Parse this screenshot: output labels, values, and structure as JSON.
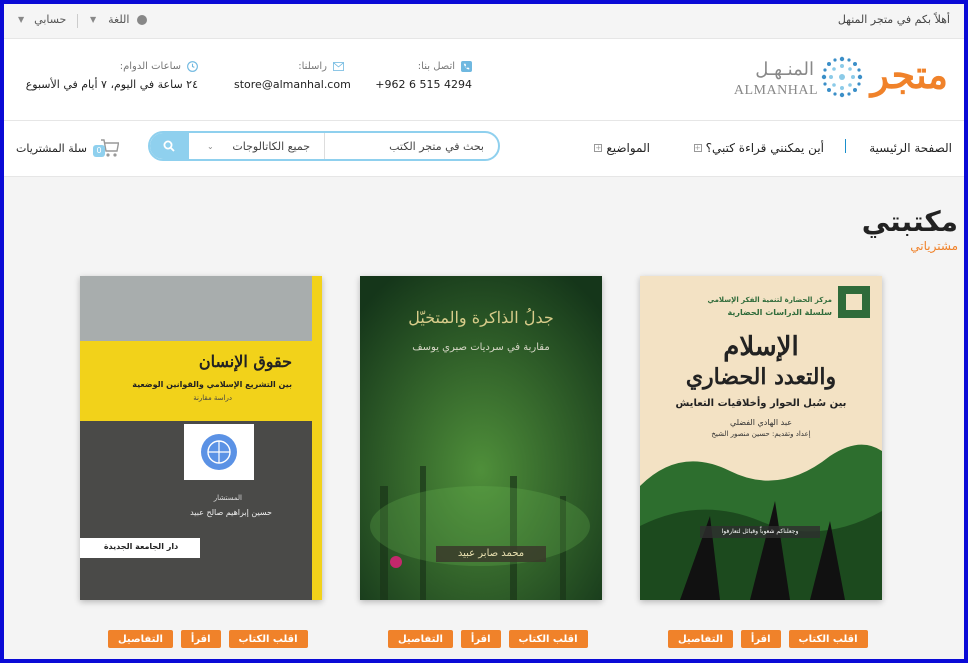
{
  "topbar": {
    "welcome": "أهلاً بكم في متجر المنهل",
    "language": "اللغة",
    "account": "حسابي"
  },
  "logo": {
    "ar_main": "متجر",
    "ar_sub": "المنـهـل",
    "en_sub": "ALMANHAL"
  },
  "contact": {
    "phone_label": "اتصل بنا:",
    "phone": "+962 6 515 4294",
    "email_label": "راسلنا:",
    "email": "store@almanhal.com",
    "hours_label": "ساعات الدوام:",
    "hours": "٢٤ ساعة في اليوم، ٧ أيام في الأسبوع"
  },
  "nav": {
    "home": "الصفحة الرئيسية",
    "where_read": "أين يمكنني قراءة كتبي؟",
    "topics": "المواضيع"
  },
  "search": {
    "placeholder": "بحث في متجر الكتب",
    "category": "جميع الكاتالوجات"
  },
  "cart": {
    "label": "سلة المشتريات",
    "count": "0"
  },
  "page": {
    "title": "مكتبتي",
    "subtitle": "مشترياتي"
  },
  "book_actions": {
    "flip": "اقلب الكتاب",
    "read": "اقرأ",
    "details": "التفاصيل"
  },
  "books": [
    {
      "publisher_line1": "مركز الحضارة لتنمية الفكر الإسلامي",
      "series": "سلسلة الدراسات الحضارية",
      "title_line1": "الإسلام",
      "title_line2": "والتعدد الحضاري",
      "subtitle": "بين سُبل الحوار وأخلاقيات التعايش",
      "author": "عبد الهادي الفضلي",
      "editor": "إعداد وتقديم: حسين منصور الشيخ",
      "quote": "وجعلناكم شعوباً وقبائل لتعارفوا"
    },
    {
      "title": "جدلُ الذاكرة والمتخيّل",
      "subtitle": "مقاربة في سرديات صبري يوسف",
      "author": "محمد صابر عبيد"
    },
    {
      "title": "حقوق الإنسان",
      "subtitle": "بين التشريع الإسلامي والقوانين الوضعية",
      "note": "دراسة مقارنة",
      "author_label": "المستشار",
      "author": "حسين إبراهيم صالح عبيد",
      "publisher": "دار الجامعة الجديدة"
    }
  ],
  "colors": {
    "accent": "#f0822a",
    "search": "#8fd0ee",
    "frame": "#0a0ad6"
  }
}
